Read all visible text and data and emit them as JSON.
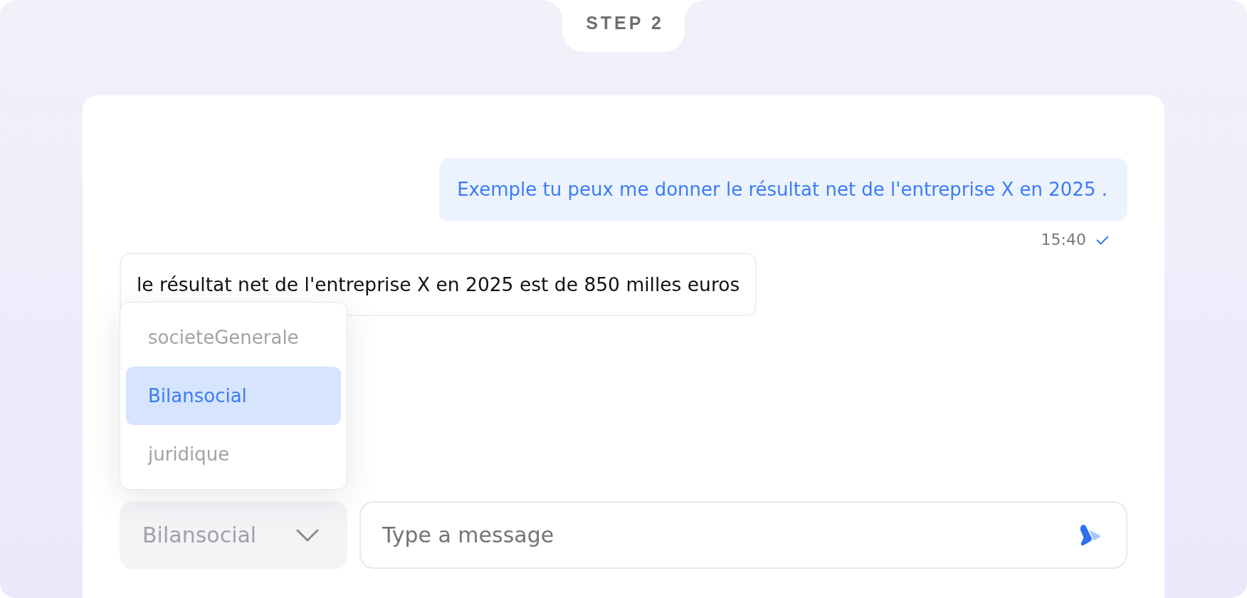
{
  "step_label": "STEP 2",
  "messages": [
    {
      "kind": "sent",
      "text": "Exemple tu peux me donner le résultat net de l'entreprise X en 2025 .",
      "time": "15:40",
      "read": true
    },
    {
      "kind": "received",
      "text": "le résultat net de l'entreprise X en 2025 est de 850 milles euros"
    }
  ],
  "source_menu": {
    "items": [
      {
        "label": "societeGenerale",
        "selected": false
      },
      {
        "label": "Bilansocial",
        "selected": true
      },
      {
        "label": "juridique",
        "selected": false
      }
    ]
  },
  "composer": {
    "source_select": {
      "value": "Bilansocial",
      "expanded": true
    },
    "message_field": {
      "placeholder": "Type a message"
    }
  }
}
